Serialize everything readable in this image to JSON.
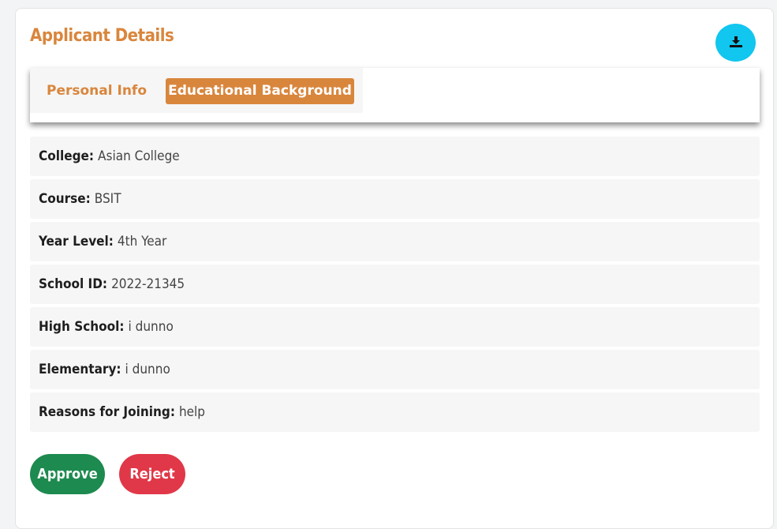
{
  "card": {
    "title": "Applicant Details",
    "download_icon": "download-icon"
  },
  "tabs": [
    {
      "label": "Personal Info",
      "active": false
    },
    {
      "label": "Educational Background",
      "active": true
    }
  ],
  "details": [
    {
      "label": "College:",
      "value": "Asian College"
    },
    {
      "label": "Course:",
      "value": "BSIT"
    },
    {
      "label": "Year Level:",
      "value": "4th Year"
    },
    {
      "label": "School ID:",
      "value": "2022-21345"
    },
    {
      "label": "High School:",
      "value": "i dunno"
    },
    {
      "label": "Elementary:",
      "value": "i dunno"
    },
    {
      "label": "Reasons for Joining:",
      "value": "help"
    }
  ],
  "actions": {
    "approve_label": "Approve",
    "reject_label": "Reject"
  },
  "colors": {
    "accent": "#d9863d",
    "download": "#11c6ef",
    "approve": "#1d8a4f",
    "reject": "#e03848"
  }
}
